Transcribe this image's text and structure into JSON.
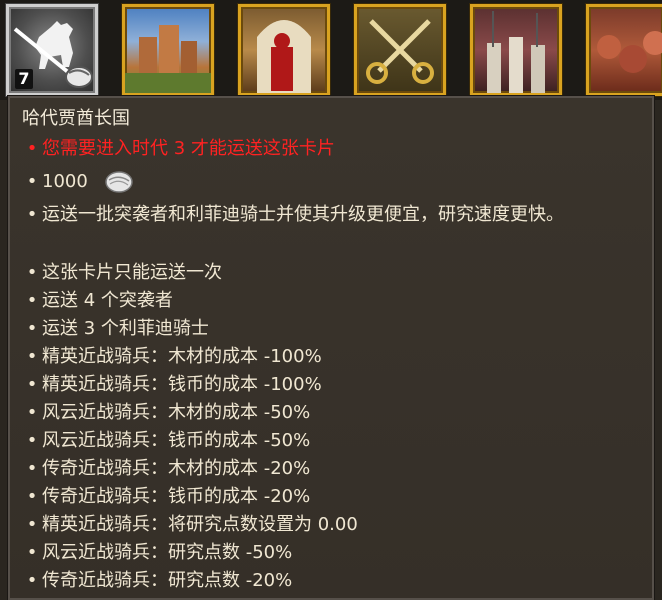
{
  "cards": [
    {
      "name": "hussar-lancer-card",
      "selected": true,
      "count": "7"
    },
    {
      "name": "city-card",
      "selected": false
    },
    {
      "name": "soldier-portrait-card",
      "selected": false
    },
    {
      "name": "crossed-horns-card",
      "selected": false
    },
    {
      "name": "pikemen-card",
      "selected": false
    },
    {
      "name": "food-card",
      "selected": false
    }
  ],
  "tooltip": {
    "title": "哈代贾酋长国",
    "requirement": "您需要进入时代 3 才能运送这张卡片",
    "cost": "1000",
    "description": "运送一批突袭者和利菲迪骑士并使其升级更便宜，研究速度更快。",
    "bullet": "•",
    "effects": [
      "这张卡片只能运送一次",
      "运送 4 个突袭者",
      "运送 3 个利菲迪骑士",
      "精英近战骑兵：木材的成本 -100%",
      "精英近战骑兵：钱币的成本 -100%",
      "风云近战骑兵：木材的成本 -50%",
      "风云近战骑兵：钱币的成本 -50%",
      "传奇近战骑兵：木材的成本 -20%",
      "传奇近战骑兵：钱币的成本 -20%",
      "精英近战骑兵：将研究点数设置为 0.00",
      "风云近战骑兵：研究点数 -50%",
      "传奇近战骑兵：研究点数 -20%"
    ]
  },
  "colors": {
    "warning": "#ff2222",
    "text": "#f0e7d2",
    "gold_border": "#d9a320"
  }
}
